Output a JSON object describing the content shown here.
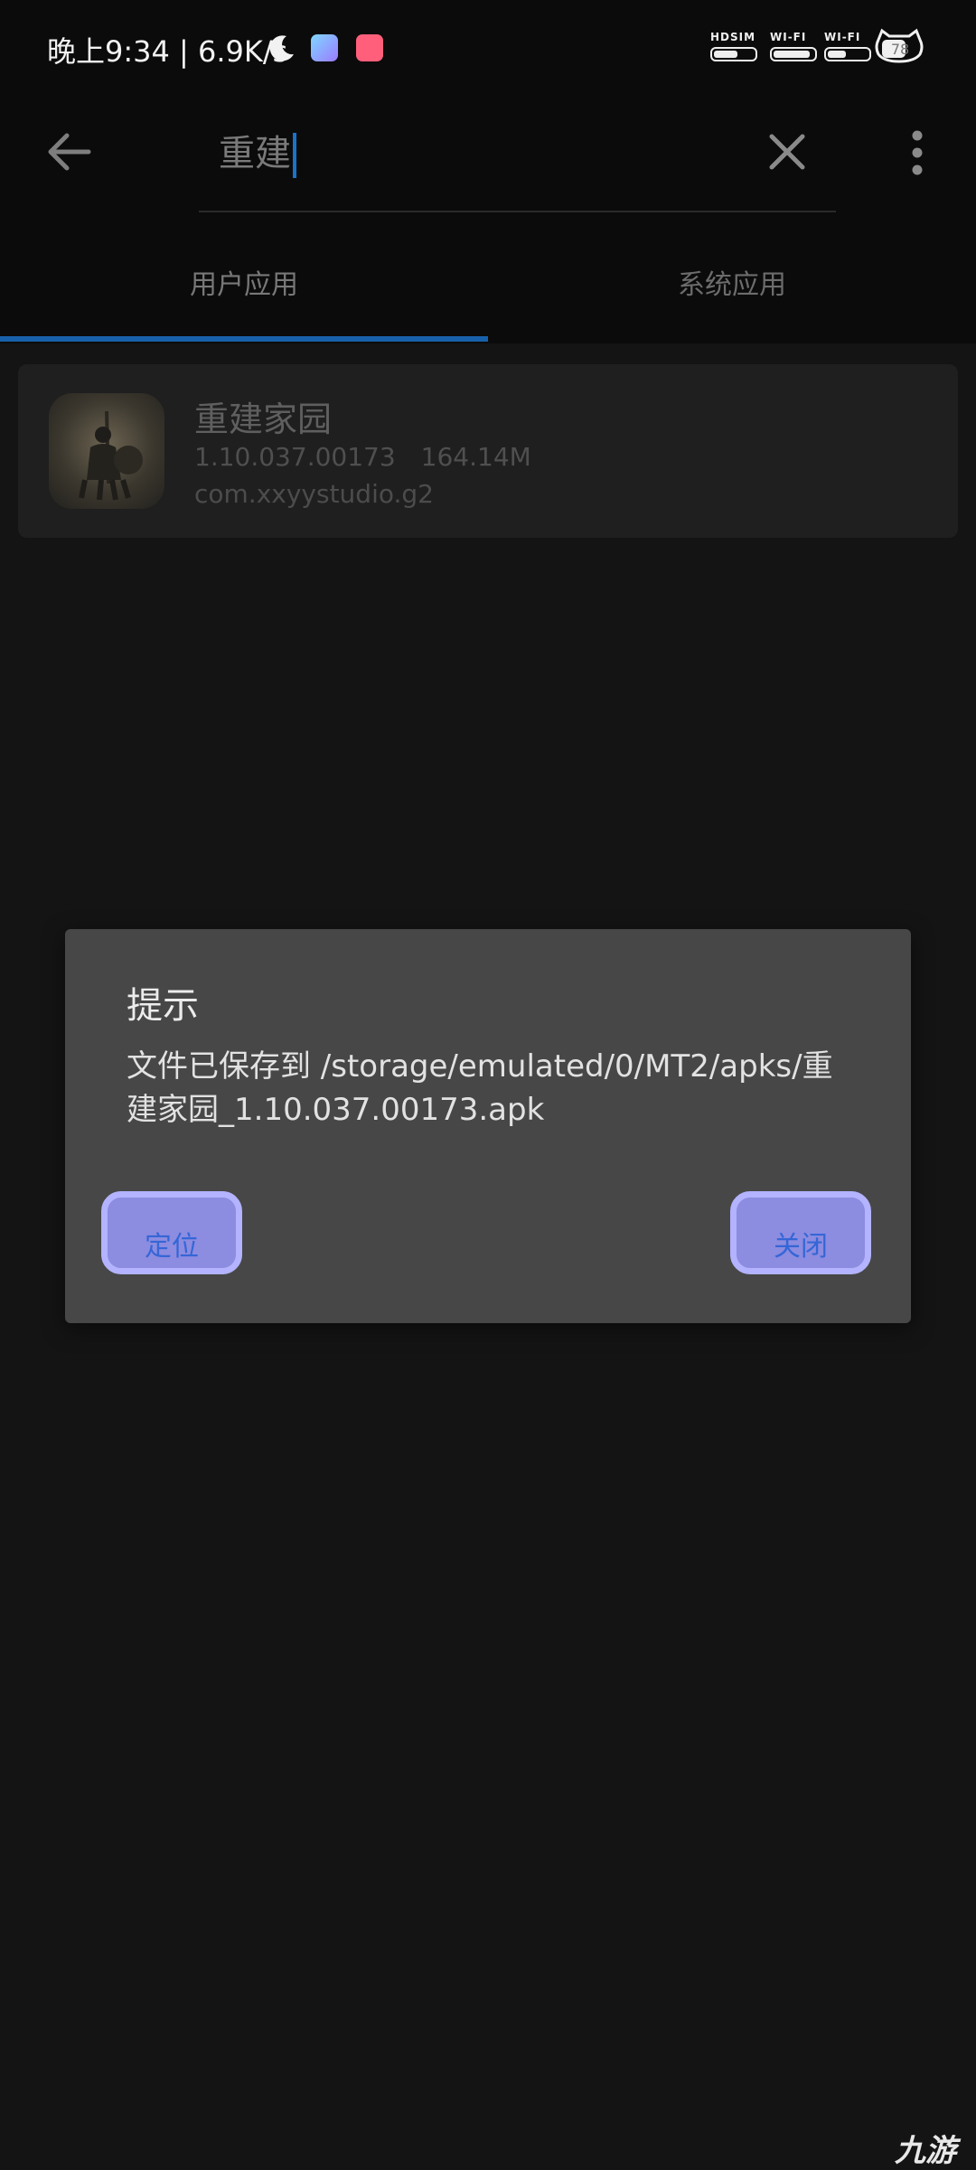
{
  "status_bar": {
    "time_speed": "晚上9:34 | 6.9K/s",
    "signals": [
      {
        "label": "HDSIM",
        "level": 0.6
      },
      {
        "label": "WI-FI",
        "level": 1.0
      },
      {
        "label": "WI-FI",
        "level": 0.5
      }
    ],
    "battery": "78"
  },
  "search": {
    "value": "重建"
  },
  "tabs": [
    {
      "label": "用户应用",
      "selected": true
    },
    {
      "label": "系统应用",
      "selected": false
    }
  ],
  "app_list": [
    {
      "name": "重建家园",
      "version": "1.10.037.00173",
      "size": "164.14M",
      "package": "com.xxyystudio.g2"
    }
  ],
  "dialog": {
    "title": "提示",
    "message": "文件已保存到 /storage/emulated/0/MT2/apks/重建家园_1.10.037.00173.apk",
    "locate_label": "定位",
    "close_label": "关闭"
  },
  "watermark": "九游",
  "colors": {
    "accent": "#1761aa",
    "dialog_bg": "#474747",
    "button_fill": "#8c8ce0",
    "button_border": "#b3b3ff"
  }
}
